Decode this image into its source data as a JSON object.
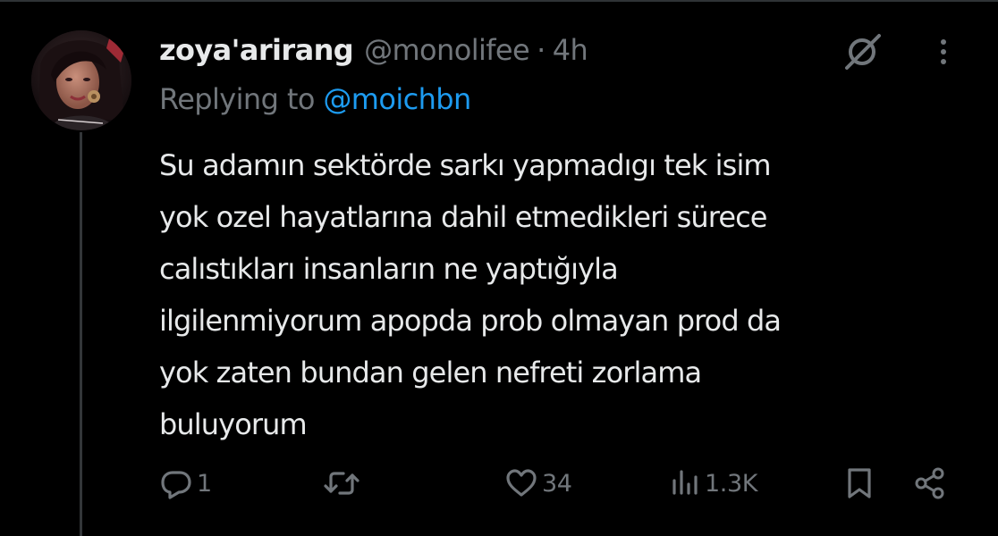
{
  "tweet": {
    "author": {
      "display_name": "zoya'arirang",
      "handle": "@monolifee",
      "separator": "·",
      "time": "4h"
    },
    "reply": {
      "prefix": "Replying to",
      "mention": "@moichbn"
    },
    "text_lines": [
      "Su adamın sektörde sarkı yapmadıgı tek isim",
      "yok ozel hayatlarına dahil etmedikleri sürece",
      "calıstıkları insanların ne yaptığıyla",
      "ilgilenmiyorum apopda prob olmayan prod da",
      "yok zaten bundan gelen nefreti zorlama",
      "buluyorum"
    ],
    "actions": {
      "replies": "1",
      "likes": "34",
      "views": "1.3K"
    }
  },
  "icons": {
    "grok": "grok-icon",
    "more": "more-vertical-icon",
    "reply": "reply-icon",
    "retweet": "retweet-icon",
    "like": "heart-icon",
    "views": "views-bar-chart-icon",
    "bookmark": "bookmark-icon",
    "share": "share-icon"
  },
  "colors": {
    "background": "#000000",
    "primary_text": "#e7e9ea",
    "secondary_text": "#71767b",
    "accent": "#1d9bf0",
    "thread_line": "#333639"
  }
}
